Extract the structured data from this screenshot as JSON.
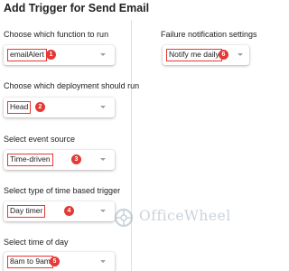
{
  "title": "Add Trigger for Send Email",
  "left_fields": [
    {
      "label": "Choose which function to run",
      "value": "emailAlert",
      "badge": "1"
    },
    {
      "label": "Choose which deployment should run",
      "value": "Head",
      "badge": "2"
    },
    {
      "label": "Select event source",
      "value": "Time-driven",
      "badge": "3"
    },
    {
      "label": "Select type of time based trigger",
      "value": "Day timer",
      "badge": "4"
    },
    {
      "label": "Select time of day",
      "value": "8am to 9am",
      "badge": "5"
    }
  ],
  "right_field": {
    "label": "Failure notification settings",
    "value": "Notify me daily",
    "badge": "6"
  },
  "watermark": "OfficeWheel",
  "colors": {
    "highlight": "#e53935",
    "badge_text": "#ffffff",
    "arrow": "#9aa0a6"
  }
}
